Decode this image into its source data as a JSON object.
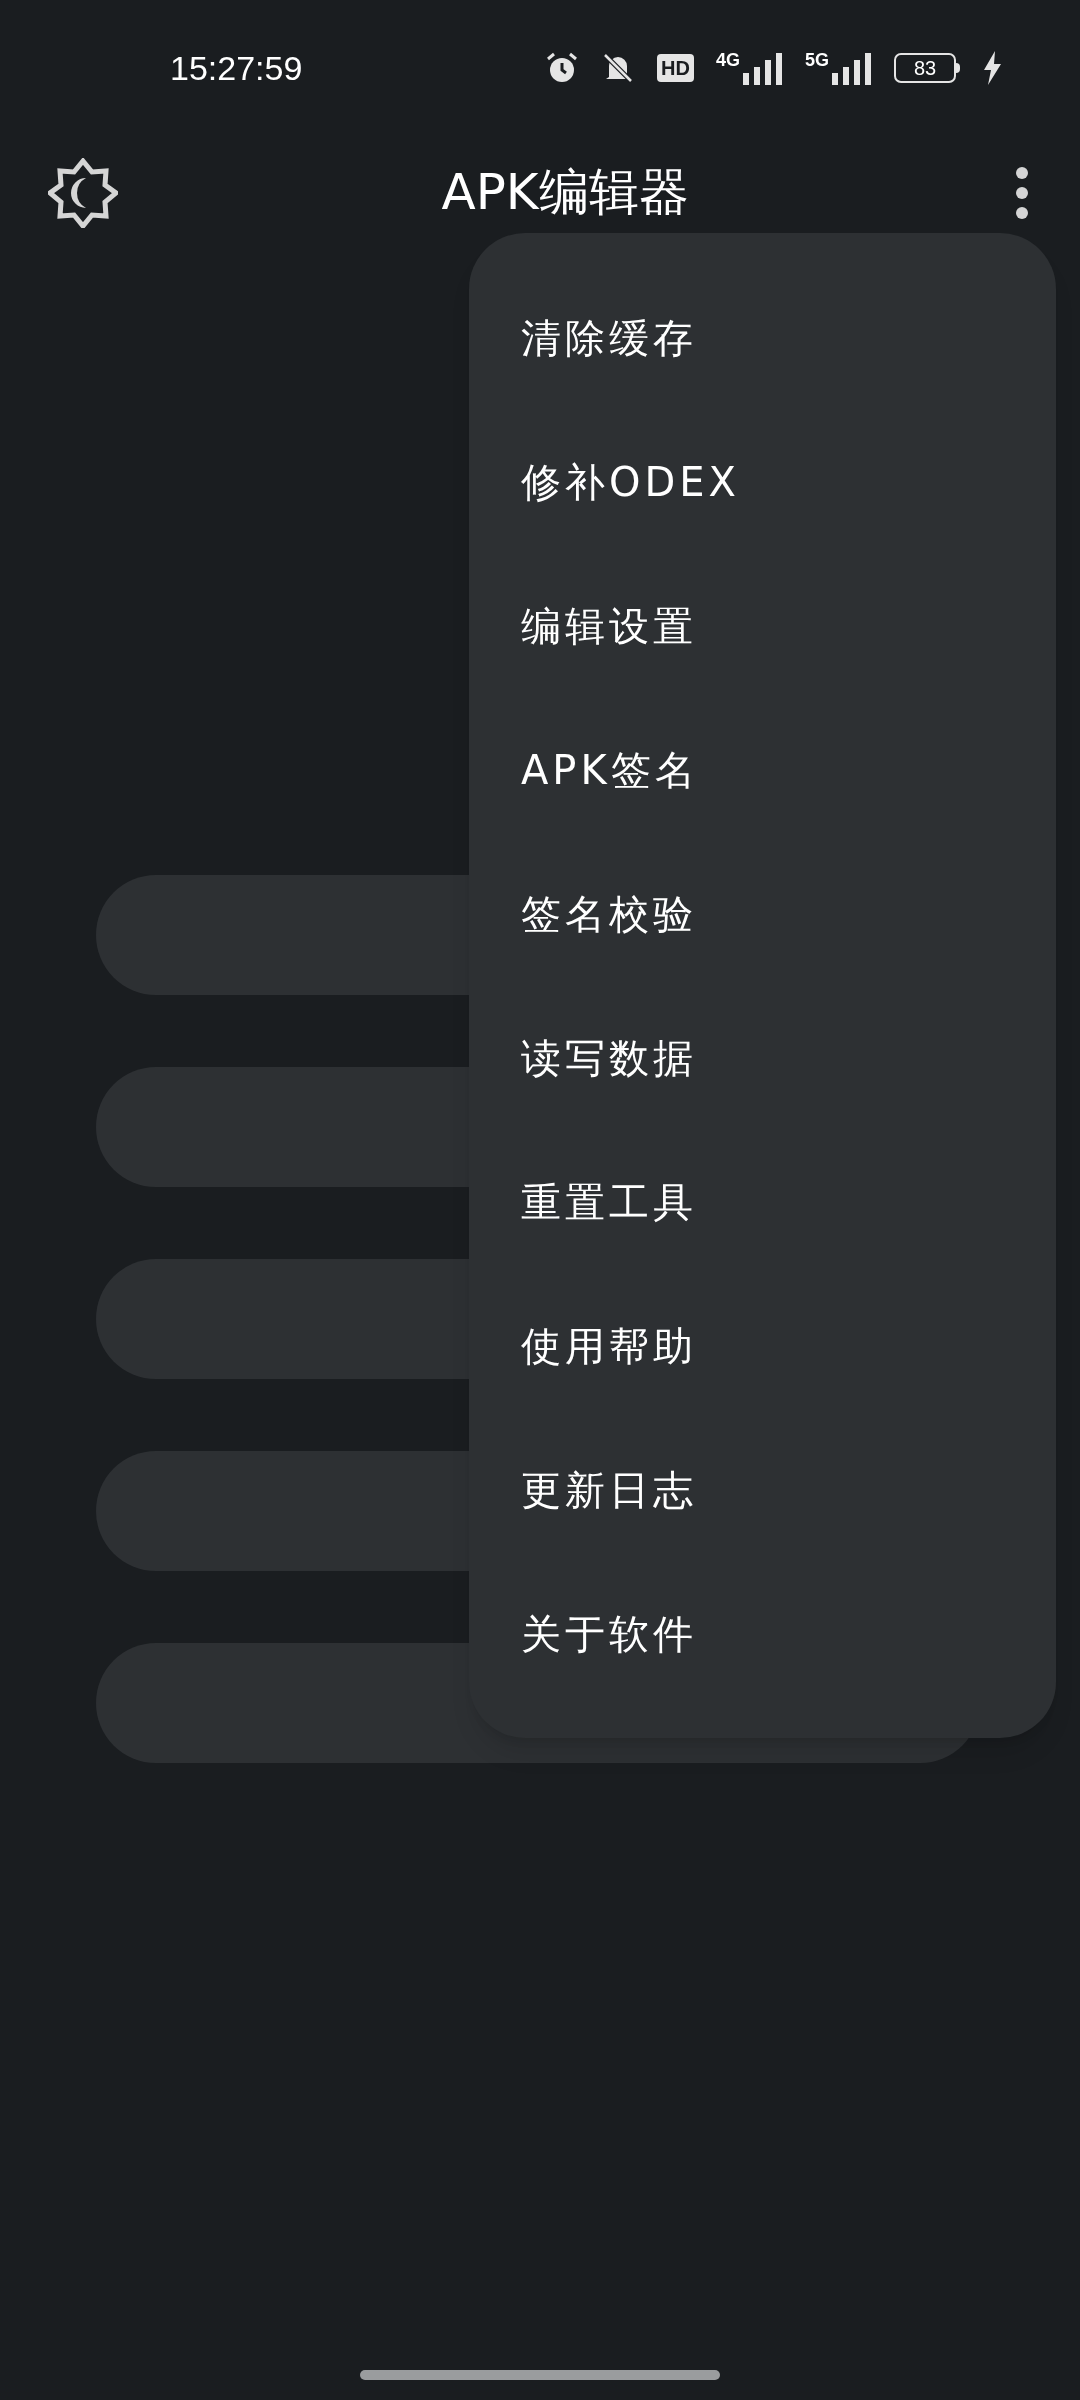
{
  "status_bar": {
    "time": "15:27:59",
    "hd": "HD",
    "sim1": "4G",
    "sim2": "5G",
    "battery": "83"
  },
  "app_bar": {
    "title": "APK编辑器"
  },
  "buttons_behind": [
    {
      "kind": "pill"
    },
    {
      "kind": "pill"
    },
    {
      "kind": "pill"
    },
    {
      "kind": "pill"
    },
    {
      "kind": "pill"
    }
  ],
  "menu": {
    "items": [
      {
        "label": "清除缓存"
      },
      {
        "label": "修补ODEX"
      },
      {
        "label": "编辑设置"
      },
      {
        "label": "APK签名"
      },
      {
        "label": "签名校验"
      },
      {
        "label": "读写数据"
      },
      {
        "label": "重置工具"
      },
      {
        "label": "使用帮助"
      },
      {
        "label": "更新日志"
      },
      {
        "label": "关于软件"
      }
    ]
  }
}
